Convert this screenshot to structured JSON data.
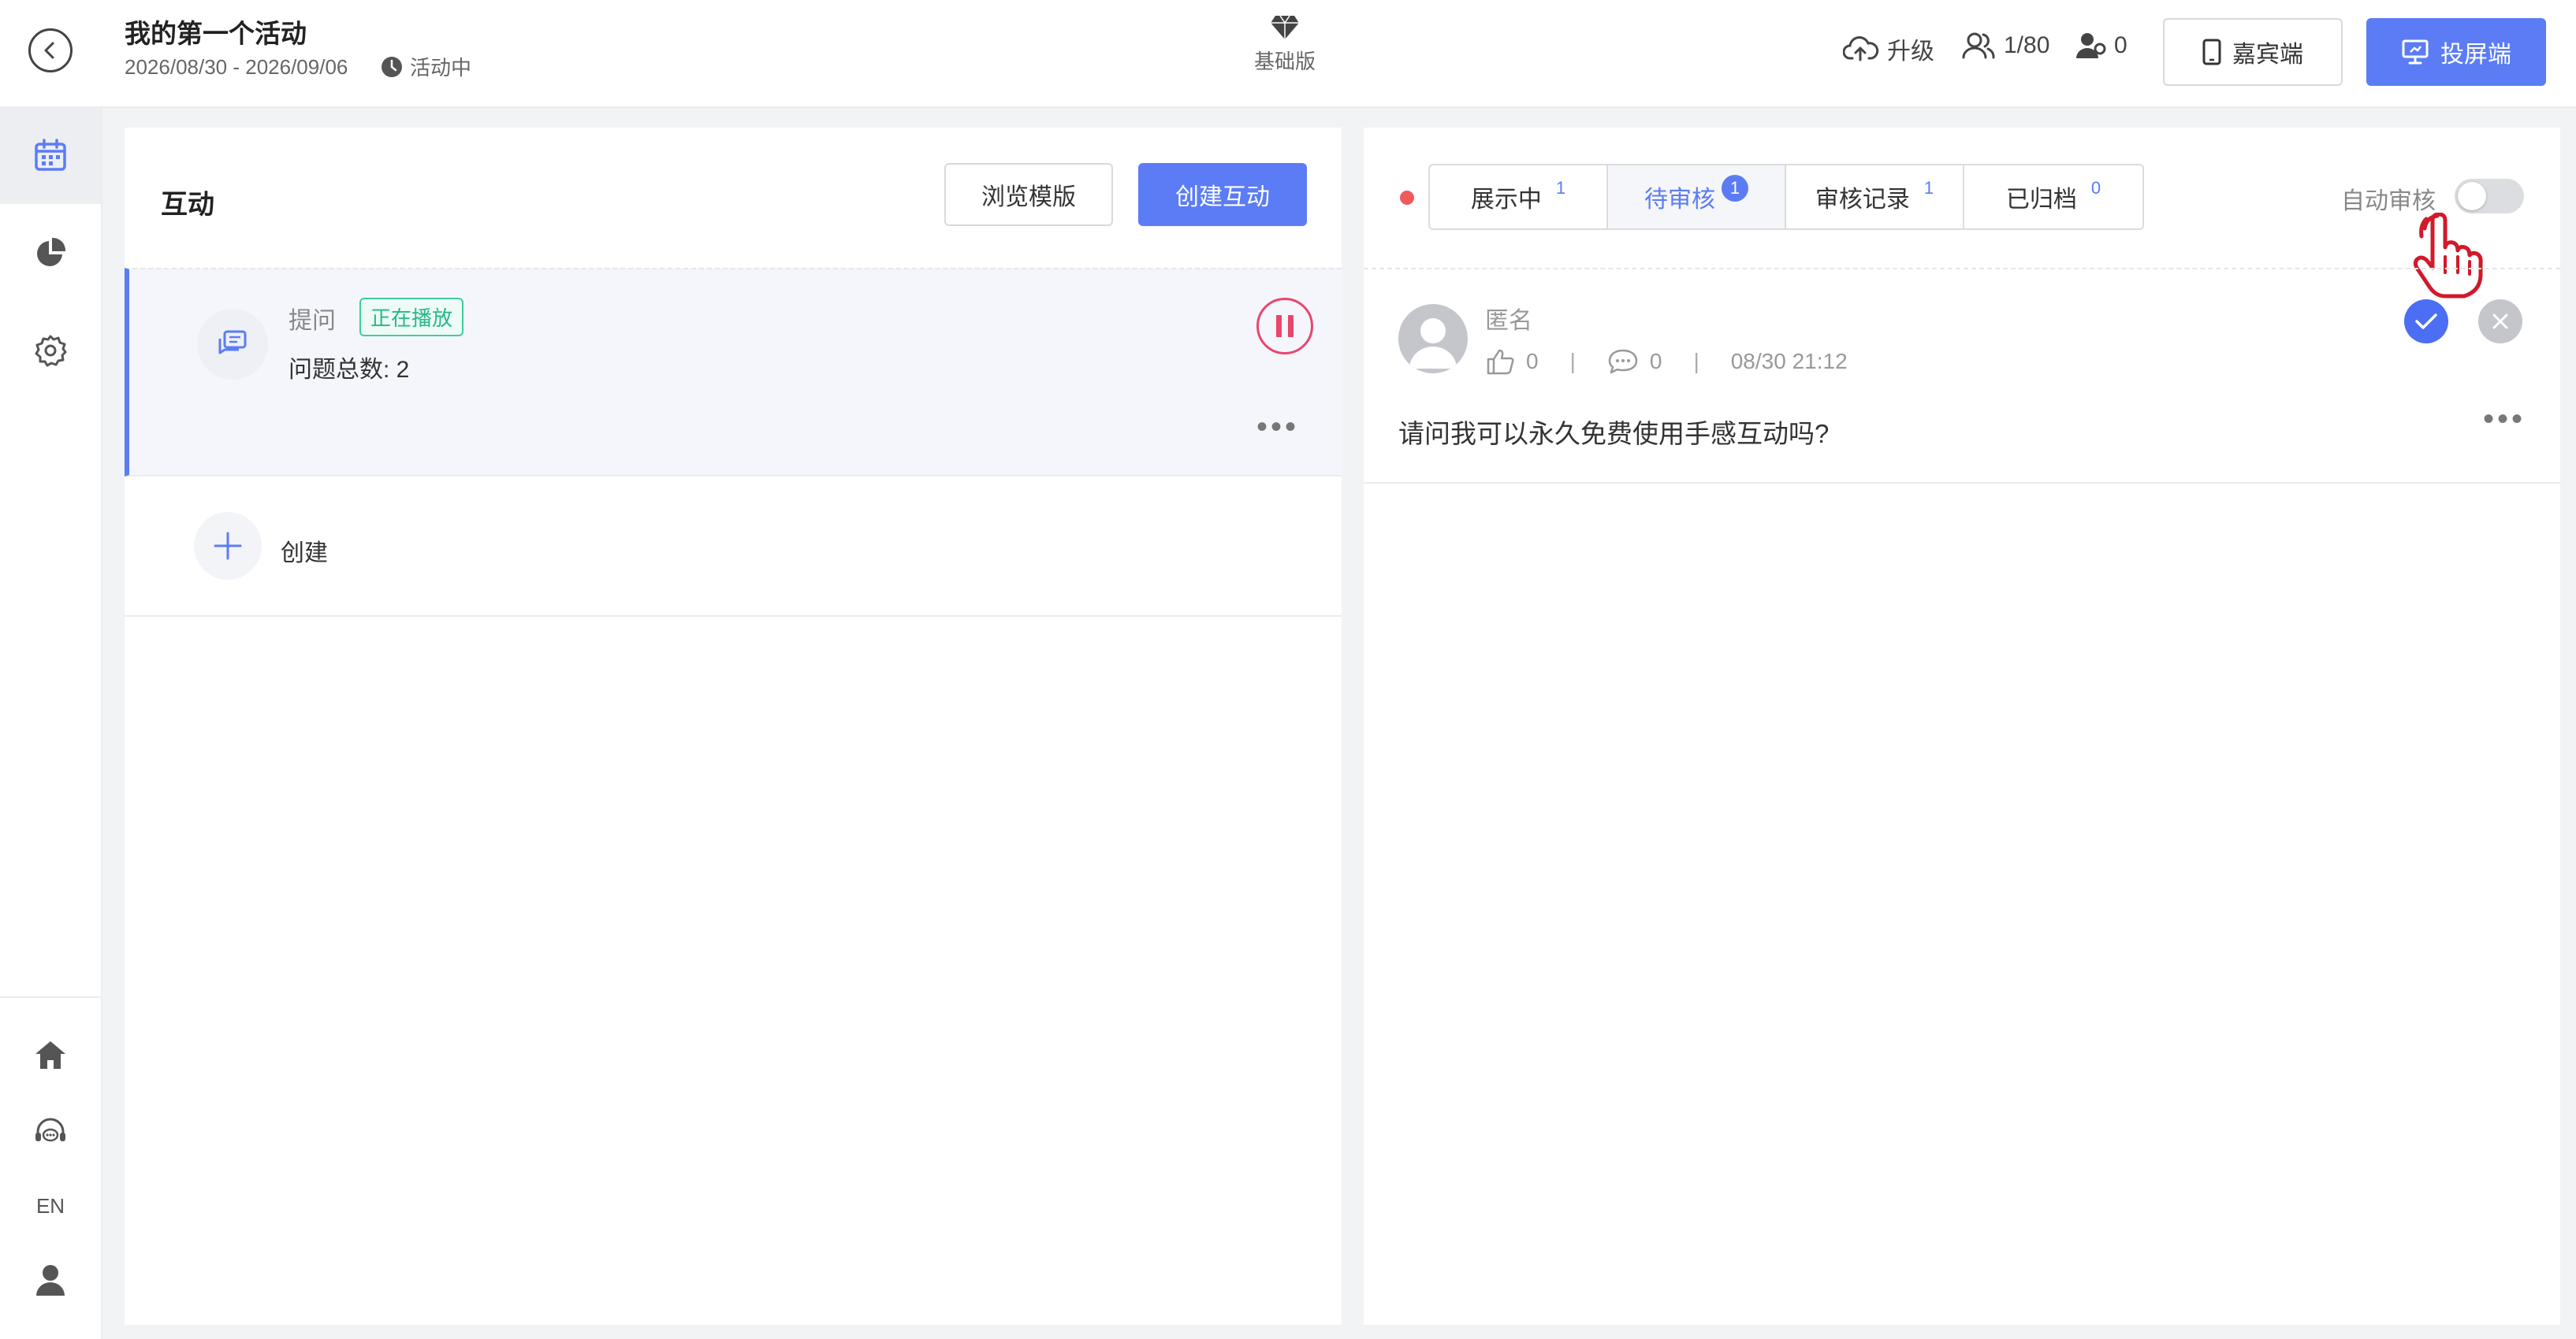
{
  "header": {
    "title": "我的第一个活动",
    "dates": "2026/08/30 - 2026/09/06",
    "status": "活动中",
    "plan": "基础版",
    "upgrade_label": "升级",
    "participants": "1/80",
    "online_count": "0",
    "guest_label": "嘉宾端",
    "screen_label": "投屏端",
    "accent_color": "#5b7cf5"
  },
  "sidebar": {
    "items": [
      {
        "icon": "calendar-icon",
        "active": true
      },
      {
        "icon": "pie-chart-icon"
      },
      {
        "icon": "gear-icon"
      }
    ],
    "bottom": [
      {
        "icon": "home-icon"
      },
      {
        "icon": "support-headset-icon"
      },
      {
        "label": "EN"
      },
      {
        "icon": "user-icon"
      }
    ]
  },
  "left_panel": {
    "title": "互动",
    "browse_label": "浏览模版",
    "create_label": "创建互动",
    "item": {
      "type": "提问",
      "badge": "正在播放",
      "count_text": "问题总数: 2"
    },
    "add_label": "创建"
  },
  "right_panel": {
    "tabs": [
      {
        "label": "展示中",
        "count": "1"
      },
      {
        "label": "待审核",
        "count": "1",
        "active": true
      },
      {
        "label": "审核记录",
        "count": "1"
      },
      {
        "label": "已归档",
        "count": "0"
      }
    ],
    "auto_review_label": "自动审核",
    "question": {
      "author": "匿名",
      "likes": "0",
      "comments": "0",
      "time": "08/30 21:12",
      "text": "请问我可以永久免费使用手感互动吗?"
    }
  }
}
